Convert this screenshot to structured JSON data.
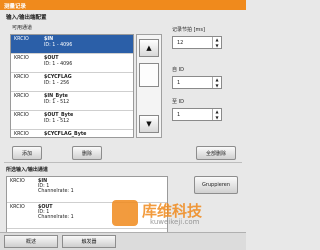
{
  "window": {
    "title": "测量记录"
  },
  "io_group": {
    "title": "输入/输出端配置",
    "available_label": "可用通道"
  },
  "available_list": [
    {
      "source": "KRCIO",
      "name": "$IN",
      "detail": "ID: 1 - 4096",
      "selected": true
    },
    {
      "source": "KRCIO",
      "name": "$OUT",
      "detail": "ID: 1 - 4096",
      "selected": false
    },
    {
      "source": "KRCIO",
      "name": "$CYCFLAG",
      "detail": "ID: 1 - 256",
      "selected": false
    },
    {
      "source": "KRCIO",
      "name": "$IN_Byte",
      "detail": "ID: 1 - 512",
      "selected": false
    },
    {
      "source": "KRCIO",
      "name": "$OUT_Byte",
      "detail": "ID: 1 - 512",
      "selected": false
    },
    {
      "source": "KRCIO",
      "name": "$CYCFLAG_Byte",
      "detail": "",
      "selected": false
    }
  ],
  "record_step": {
    "label": "记录节拍 [ms]",
    "value": "12"
  },
  "from_id": {
    "label": "自 ID",
    "value": "1"
  },
  "to_id": {
    "label": "至 ID",
    "value": "1"
  },
  "buttons": {
    "add": "添加",
    "delete": "删除",
    "delete_all": "全部删除",
    "group": "Gruppieren"
  },
  "selected_group": {
    "label": "所选输入/输出通道"
  },
  "selected_list": [
    {
      "source": "KRCIO",
      "name": "$IN",
      "id": "ID: 1",
      "rate": "Channelrate: 1"
    },
    {
      "source": "KRCIO",
      "name": "$OUT",
      "id": "ID: 1",
      "rate": "Channelrate: 1"
    }
  ],
  "tabs": {
    "overview": "概述",
    "trigger": "触发器"
  },
  "watermark": {
    "text": "库维科技",
    "url": "kuweikeji.com"
  }
}
